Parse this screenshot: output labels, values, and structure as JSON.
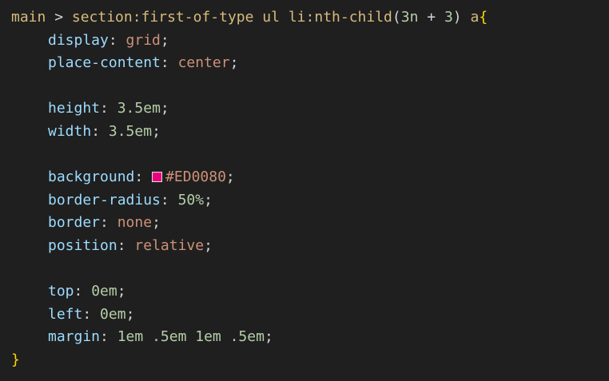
{
  "colors": {
    "background": "#1f1f1f",
    "selector": "#d7ba7d",
    "property": "#9cdcfe",
    "string_value": "#ce9178",
    "number": "#b5cea8",
    "brace": "#ffd700",
    "swatch": "#ED0080"
  },
  "selector": {
    "main": "main",
    "combinator": " > ",
    "section": "section",
    "first_pseudo": ":first-of-type",
    "space1": " ",
    "ul": "ul",
    "space2": " ",
    "li": "li",
    "nth_pseudo": ":nth-child",
    "paren_open": "(",
    "n3": "3n",
    "plus": " + ",
    "three": "3",
    "paren_close": ")",
    "space3": " ",
    "a": "a",
    "open_brace": "{"
  },
  "decls": [
    {
      "prop": "display",
      "value": "grid",
      "kind": "val"
    },
    {
      "prop": "place-content",
      "value": "center",
      "kind": "val"
    },
    {
      "prop": "height",
      "value": "3.5em",
      "kind": "num"
    },
    {
      "prop": "width",
      "value": "3.5em",
      "kind": "num"
    },
    {
      "prop": "background",
      "value": "#ED0080",
      "kind": "val"
    },
    {
      "prop": "border-radius",
      "value": "50%",
      "kind": "num"
    },
    {
      "prop": "border",
      "value": "none",
      "kind": "val"
    },
    {
      "prop": "position",
      "value": "relative",
      "kind": "val"
    },
    {
      "prop": "top",
      "value": "0em",
      "kind": "num"
    },
    {
      "prop": "left",
      "value": "0em",
      "kind": "num"
    },
    {
      "prop": "margin",
      "value": "1em .5em 1em .5em",
      "kind": "num"
    }
  ],
  "close_brace": "}",
  "colon": ": ",
  "semicolon": ";"
}
